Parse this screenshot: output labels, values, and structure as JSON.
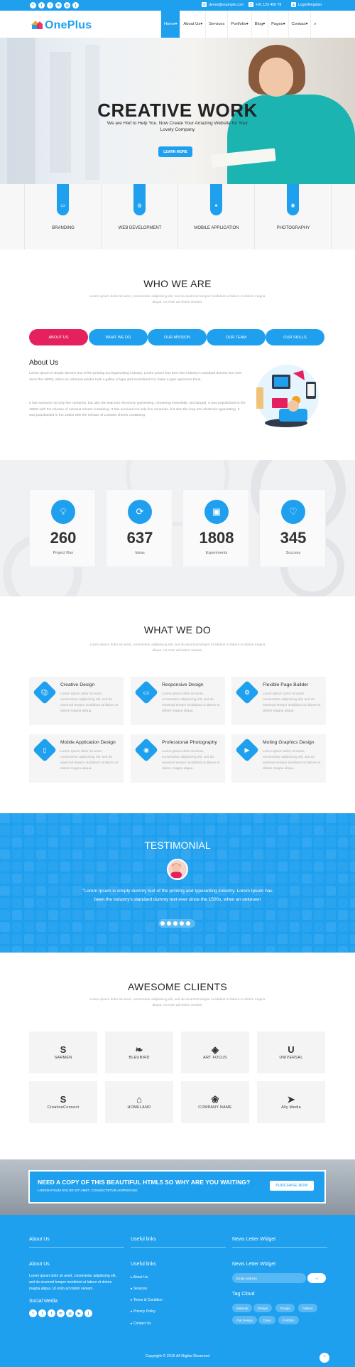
{
  "topbar": {
    "social_icons": [
      "facebook-icon",
      "twitter-icon",
      "tumblr-icon",
      "linkedin-icon",
      "instagram-icon",
      "rss-icon"
    ],
    "email": "demo@example.com",
    "phone": "+01 123 456 78",
    "login": "Login/Register"
  },
  "header": {
    "logo": "OnePlus",
    "nav": [
      "Home",
      "About Us",
      "Services",
      "Portfolio",
      "Blog",
      "Pages",
      "Contact"
    ]
  },
  "hero": {
    "title": "CREATIVE WORK",
    "subtitle": "We are Hief to Help You. Now Create Your Amazing Website for Your Lovely Company",
    "button": "LEARN MORE"
  },
  "services": [
    {
      "label": "BRANDING",
      "icon": "monitor-icon"
    },
    {
      "label": "WEB DEVELOPMENT",
      "icon": "globe-icon"
    },
    {
      "label": "MOBILE APPLICATION",
      "icon": "apple-icon"
    },
    {
      "label": "PHOTOGRAPHY",
      "icon": "camera-icon"
    }
  ],
  "who": {
    "title": "WHO WE ARE",
    "subtitle": "Lorem ipsum dolor sit amet, consectetur adipisicing elit, sed do eiusmod tempor incididunt ut labore et dolore magna aliqua. Ut enim ad minim veniam.",
    "tabs": [
      "ABOUT US",
      "WHAT WE DO",
      "OUR MISSION",
      "OUR TEAM",
      "OUR SKILLS"
    ],
    "about_title": "About Us",
    "about_p1": "Lorem Ipsum is simply dummy text of the printing and typesetting industry. Lorem Ipsum has been the industry's standard dummy text ever since the 1500s, when an unknown printer took a galley of type and scrambled it to make a type specimen book.",
    "about_p2": "It has survived not only five centuries, but also the leap into electronic typesetting, remaining essentially unchanged. It was popularised in the 1960s with the release of Letraset sheets containing. It has survived not only five centuries, but also the leap into electronic typesetting. It was popularised in the 1960s with the release of Letraset sheets containing."
  },
  "counters": [
    {
      "value": "260",
      "label": "Project Run",
      "icon": "lightbulb-icon"
    },
    {
      "value": "637",
      "label": "Ideas",
      "icon": "refresh-icon"
    },
    {
      "value": "1808",
      "label": "Experiments",
      "icon": "briefcase-icon"
    },
    {
      "value": "345",
      "label": "Success",
      "icon": "heart-icon"
    }
  ],
  "what": {
    "title": "WHAT WE DO",
    "subtitle": "Lorem ipsum dolor sit amet, consectetur adipisicing elit, sed do eiusmod tempor incididunt ut labore et dolore magna aliqua. Ut enim ad minim veniam.",
    "features": [
      {
        "title": "Creative Design",
        "icon": "palette-icon",
        "text": "Lorem ipsum dolor sit amet, consectetur adipisicing elit, sed do eiusmod tempor incididunt ut labore et dolore magna aliqua."
      },
      {
        "title": "Responsive Design",
        "icon": "devices-icon",
        "text": "Lorem ipsum dolor sit amet, consectetur adipisicing elit, sed do eiusmod tempor incididunt ut labore et dolore magna aliqua."
      },
      {
        "title": "Flexible Page Builder",
        "icon": "gear-icon",
        "text": "Lorem ipsum dolor sit amet, consectetur adipisicing elit, sed do eiusmod tempor incididunt ut labore et dolore magna aliqua."
      },
      {
        "title": "Mobile Application Design",
        "icon": "mobile-icon",
        "text": "Lorem ipsum dolor sit amet, consectetur adipisicing elit, sed do eiusmod tempor incididunt ut labore et dolore magna aliqua."
      },
      {
        "title": "Professional Photography",
        "icon": "camera-icon",
        "text": "Lorem ipsum dolor sit amet, consectetur adipisicing elit, sed do eiusmod tempor incididunt ut labore et dolore magna aliqua."
      },
      {
        "title": "Moting Graphics Design",
        "icon": "video-icon",
        "text": "Lorem ipsum dolor sit amet, consectetur adipisicing elit, sed do eiusmod tempor incididunt ut labore et dolore magna aliqua."
      }
    ]
  },
  "testimonial": {
    "title": "TESTIMONIAL",
    "quote": "\"Lorem Ipsum is simply dummy text of the printing and typesetting industry. Lorem Ipsum has been the industry's standard dummy text ever since the 1500s, when an unknown"
  },
  "clients": {
    "title": "AWESOME CLIENTS",
    "subtitle": "Lorem ipsum dolor sit amet, consectetur adipisicing elit, sed do eiusmod tempor incididunt ut labore et dolore magna aliqua. Ut enim ad minim veniam.",
    "logos": [
      {
        "mark": "S",
        "name": "SARMEN"
      },
      {
        "mark": "❧",
        "name": "BLEUBIRD"
      },
      {
        "mark": "◈",
        "name": "ART FOCUS"
      },
      {
        "mark": "U",
        "name": "UNIVERSAL"
      },
      {
        "mark": "S",
        "name": "CreativeConnect"
      },
      {
        "mark": "⌂",
        "name": "HOMELAND"
      },
      {
        "mark": "❀",
        "name": "COMPANY NAME"
      },
      {
        "mark": "➤",
        "name": "Ally Media"
      }
    ]
  },
  "cta": {
    "title": "NEED A COPY OF THIS BEAUTIFUL HTML5 SO WHY ARE YOU WAITING?",
    "subtitle": "LOREM IPSUM DOLOR SIT AMET, CONSECTETUR ADIPISICING",
    "button": "PURCHASE NOW"
  },
  "footer": {
    "col1_heading_top": "About Us",
    "col2_heading_top": "Useful links",
    "col3_heading_top": "News Letter Widget",
    "about_heading": "About Us",
    "about_text": "Lorem ipsum dolor sit amet, consectetur adipisicing elit, sed do eiusmod tempor incididunt ut labore et dolore magna aliqua. Ut enim ad minim veniam.",
    "social_heading": "Social Media",
    "social_icons": [
      "facebook-icon",
      "twitter-icon",
      "tumblr-icon",
      "linkedin-icon",
      "instagram-icon",
      "youtube-icon",
      "rss-icon"
    ],
    "links_heading": "Useful links",
    "links": [
      "About Us",
      "Services",
      "Terms & Condition",
      "Privacy Policy",
      "Contact Us"
    ],
    "newsletter_heading": "News Letter Widget",
    "email_placeholder": "Email Address",
    "tags_heading": "Tag Cloud",
    "tags": [
      "Material",
      "Design",
      "Google",
      "Gallery",
      "Flat Design",
      "Clean",
      "Portfolio"
    ],
    "copyright": "Copyright © 2016 All Rights Reserved"
  }
}
